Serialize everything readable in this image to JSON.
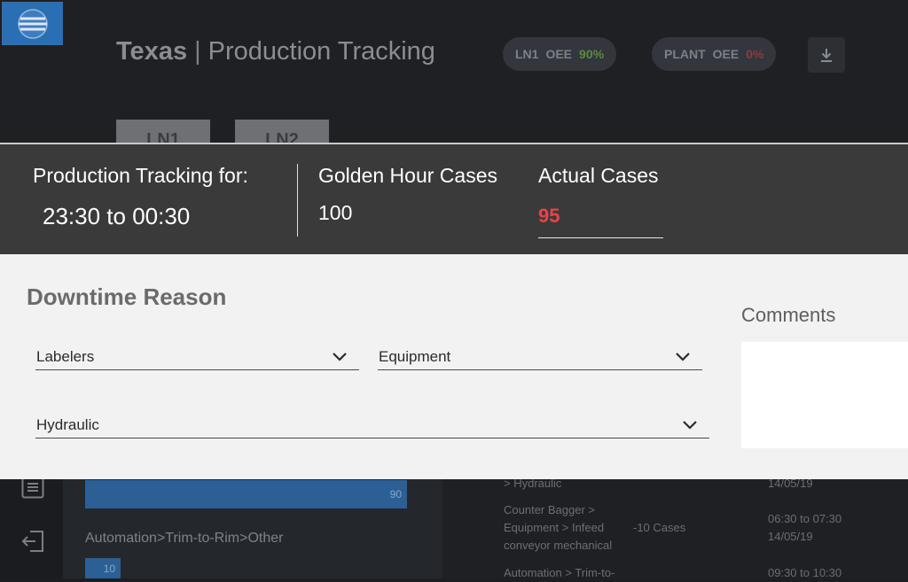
{
  "app": {
    "header": {
      "site": "Texas",
      "separator": "|",
      "page": "Production Tracking",
      "pills": [
        {
          "name": "LN1",
          "metric": "OEE",
          "value": "90%"
        },
        {
          "name": "PLANT",
          "metric": "OEE",
          "value": "0%"
        }
      ]
    },
    "tabs": [
      "LN1",
      "LN2"
    ],
    "chart": {
      "bars": [
        {
          "value": "90"
        },
        {
          "label": "Automation>Trim-to-Rim>Other",
          "value": "10"
        }
      ]
    },
    "log": {
      "rows": [
        {
          "reason": [
            "> Hydraulic"
          ],
          "cases": "",
          "time": [
            "14/05/19"
          ]
        },
        {
          "reason": [
            "Counter Bagger >",
            "Equipment > Infeed",
            "conveyor mechanical"
          ],
          "cases": "-10 Cases",
          "time": [
            "06:30 to 07:30",
            "14/05/19"
          ]
        },
        {
          "reason": [
            "Automation > Trim-to-"
          ],
          "cases": "",
          "time": [
            "09:30 to 10:30"
          ]
        }
      ]
    }
  },
  "modal": {
    "tracking_label": "Production Tracking for:",
    "tracking_range": "23:30 to 00:30",
    "golden_label": "Golden Hour Cases",
    "golden_value": "100",
    "actual_label": "Actual Cases",
    "actual_value": "95",
    "actual_color": "#e8434b",
    "downtime_title": "Downtime Reason",
    "selects": {
      "category": "Labelers",
      "type": "Equipment",
      "reason": "Hydraulic"
    },
    "comments_label": "Comments",
    "comments_value": ""
  },
  "icons": {
    "logo": "globe-logo",
    "download": "download-icon",
    "list": "list-icon",
    "logout": "logout-icon",
    "chevron": "chevron-down-icon"
  }
}
